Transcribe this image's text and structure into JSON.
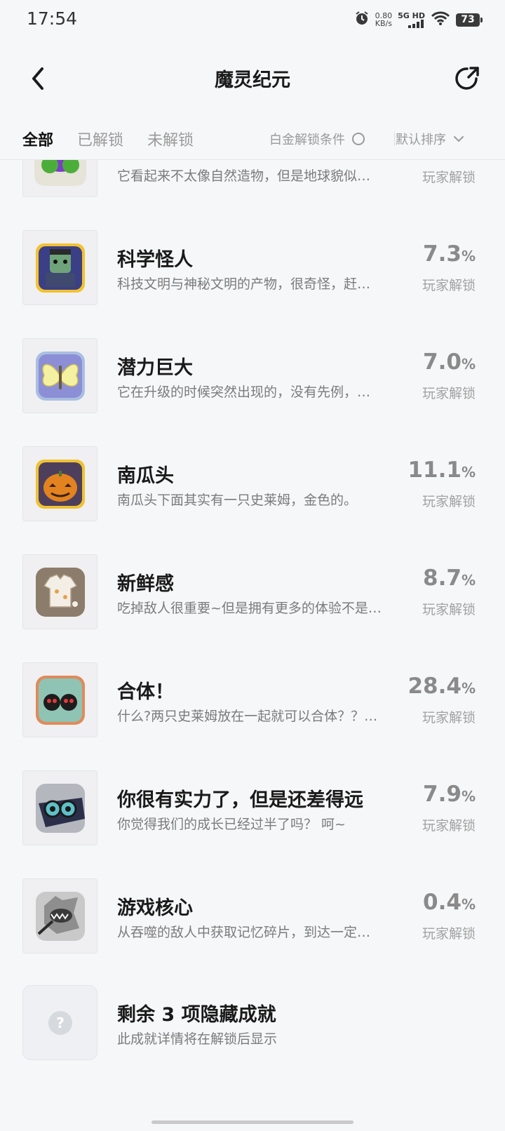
{
  "status": {
    "time": "17:54",
    "speed_value": "0.80",
    "speed_unit": "KB/s",
    "network": "5G HD",
    "battery": "73"
  },
  "header": {
    "title": "魔灵纪元"
  },
  "tabs": [
    {
      "label": "全部",
      "active": true
    },
    {
      "label": "已解锁",
      "active": false
    },
    {
      "label": "未解锁",
      "active": false
    }
  ],
  "filters": {
    "platinum": "白金解锁条件",
    "sort": "默认排序"
  },
  "achievements": [
    {
      "title": "",
      "desc": "它看起来不太像自然造物，但是地球貌似…",
      "pct": "",
      "label": "玩家解锁",
      "icon": "green-creature-icon"
    },
    {
      "title": "科学怪人",
      "desc": "科技文明与神秘文明的产物，很奇怪，赶…",
      "pct": "7.3",
      "label": "玩家解锁",
      "icon": "frankenstein-icon"
    },
    {
      "title": "潜力巨大",
      "desc": "它在升级的时候突然出现的，没有先例，…",
      "pct": "7.0",
      "label": "玩家解锁",
      "icon": "butterfly-icon"
    },
    {
      "title": "南瓜头",
      "desc": "南瓜头下面其实有一只史莱姆，金色的。",
      "pct": "11.1",
      "label": "玩家解锁",
      "icon": "pumpkin-icon"
    },
    {
      "title": "新鲜感",
      "desc": "吃掉敌人很重要~但是拥有更多的体验不是…",
      "pct": "8.7",
      "label": "玩家解锁",
      "icon": "shirt-icon"
    },
    {
      "title": "合体！",
      "desc": "什么?两只史莱姆放在一起就可以合体？？…",
      "pct": "28.4",
      "label": "玩家解锁",
      "icon": "twin-slime-icon"
    },
    {
      "title": "你很有实力了，但是还差得远",
      "desc": "你觉得我们的成长已经过半了吗？ 呵~",
      "pct": "7.9",
      "label": "玩家解锁",
      "icon": "goggles-icon"
    },
    {
      "title": "游戏核心",
      "desc": "从吞噬的敌人中获取记忆碎片，到达一定…",
      "pct": "0.4",
      "label": "玩家解锁",
      "icon": "monster-core-icon"
    },
    {
      "title": "剩余 3 项隐藏成就",
      "desc": "此成就详情将在解锁后显示",
      "pct": "",
      "label": "",
      "icon": "question-mark-icon"
    }
  ],
  "percent_sign": "%"
}
